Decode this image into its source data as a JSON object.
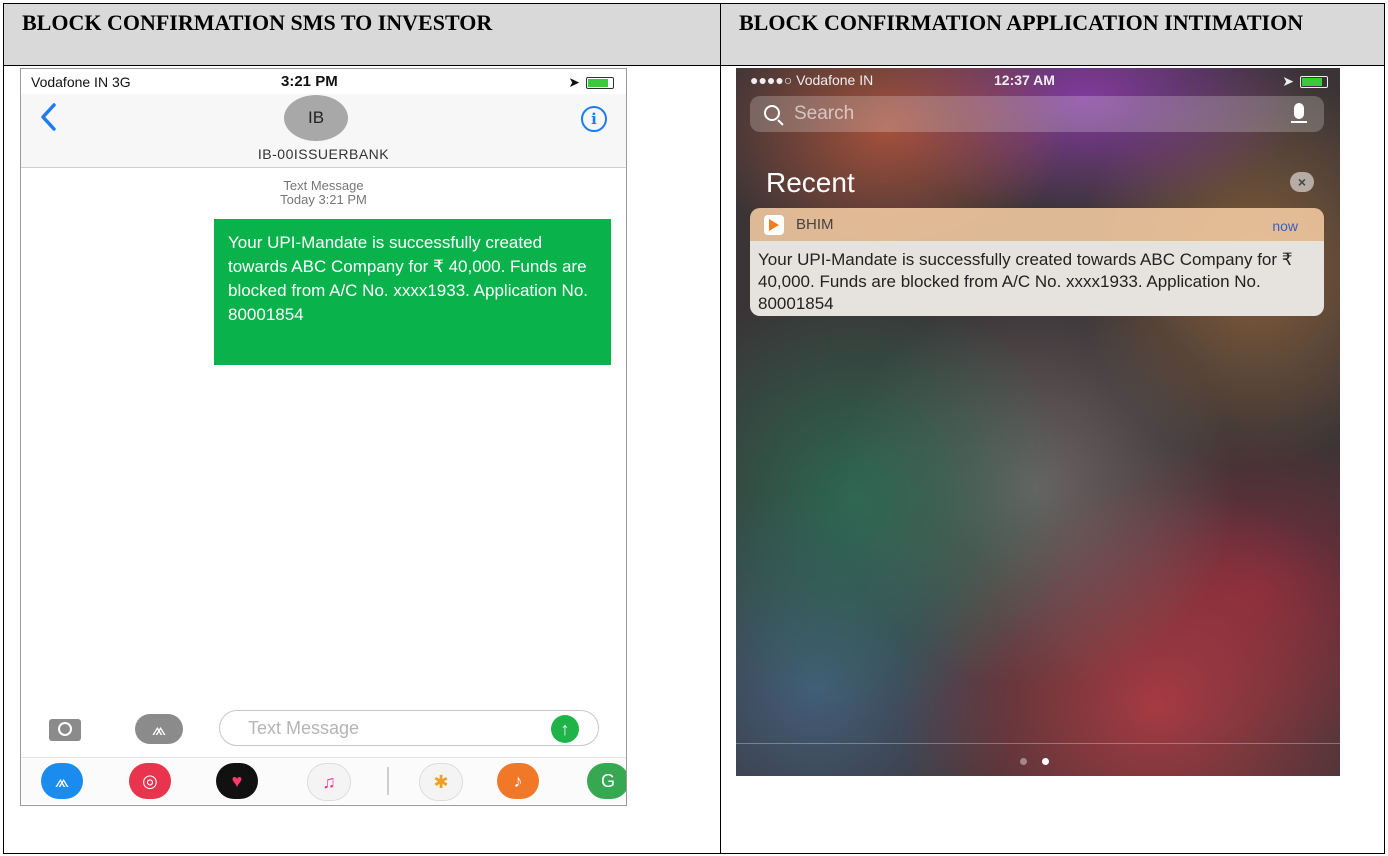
{
  "headers": {
    "left": "BLOCK CONFIRMATION SMS TO INVESTOR",
    "right": "BLOCK CONFIRMATION APPLICATION INTIMATION"
  },
  "sms": {
    "status": {
      "carrier": "Vodafone IN  3G",
      "time": "3:21 PM"
    },
    "contact": {
      "initials": "IB",
      "name": "IB-00ISSUERBANK"
    },
    "info_glyph": "i",
    "meta_line1": "Text Message",
    "meta_line2": "Today 3:21 PM",
    "message": "Your UPI-Mandate is successfully created towards ABC Company for ₹ 40,000. Funds are blocked from A/C No. xxxx1933. Application No. 80001854",
    "input_placeholder": "Text Message",
    "send_glyph": "↑",
    "icons": {
      "back": "chevron-left-icon",
      "camera": "camera-icon",
      "appstore": "app-store-icon",
      "send": "send-arrow-icon"
    },
    "colors": {
      "bubble": "#0ab24c",
      "accent": "#1e7cf0",
      "send": "#1fb34a"
    }
  },
  "notification": {
    "status": {
      "carrier": "●●●●○ Vodafone IN",
      "time": "12:37 AM"
    },
    "search_placeholder": "Search",
    "section_title": "Recent",
    "clear_glyph": "×",
    "app_name": "BHIM",
    "time_label": "now",
    "message": "Your UPI-Mandate is successfully created towards ABC Company for ₹ 40,000. Funds are blocked from A/C No. xxxx1933. Application No. 80001854",
    "icons": {
      "search": "search-icon",
      "mic": "microphone-icon",
      "app": "bhim-icon",
      "clear": "close-icon"
    }
  }
}
